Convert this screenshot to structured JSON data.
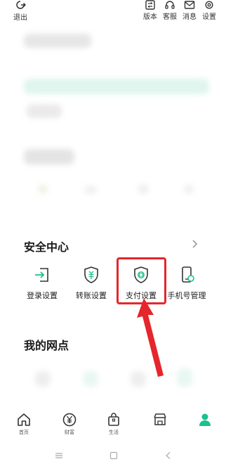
{
  "top": {
    "logout_label": "退出",
    "actions": [
      {
        "label": "版本",
        "icon": "version-icon"
      },
      {
        "label": "客服",
        "icon": "headset-icon"
      },
      {
        "label": "消息",
        "icon": "mail-icon"
      },
      {
        "label": "设置",
        "icon": "gear-icon"
      }
    ]
  },
  "security": {
    "title": "安全中心",
    "items": [
      {
        "label": "登录设置",
        "icon": "login-icon"
      },
      {
        "label": "转账设置",
        "icon": "transfer-shield-icon"
      },
      {
        "label": "支付设置",
        "icon": "payment-shield-icon"
      },
      {
        "label": "手机号管理",
        "icon": "phone-icon"
      }
    ]
  },
  "outlets": {
    "title": "我的网点"
  },
  "bottom_nav": {
    "items": [
      {
        "label": "首页",
        "icon": "home-icon"
      },
      {
        "label": "财富",
        "icon": "yen-icon"
      },
      {
        "label": "生活",
        "icon": "bag-icon"
      },
      {
        "label": "",
        "icon": "store-icon"
      },
      {
        "label": "",
        "icon": "user-icon"
      }
    ]
  },
  "colors": {
    "accent": "#1dbf8e",
    "highlight": "#e5262c",
    "text": "#222222"
  }
}
